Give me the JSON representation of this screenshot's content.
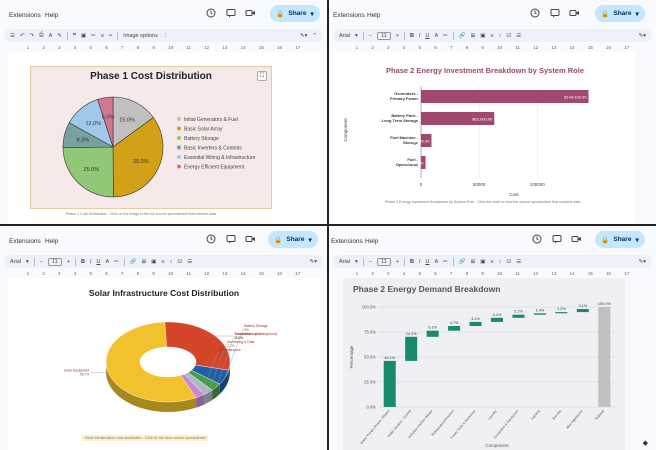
{
  "common": {
    "menu_extensions": "Extensions",
    "menu_help": "Help",
    "share": "Share",
    "font": "Arial",
    "size": "11",
    "ruler": [
      "1",
      "2",
      "3",
      "4",
      "5",
      "6",
      "7",
      "8",
      "9",
      "10",
      "11",
      "12",
      "13",
      "14",
      "15",
      "16",
      "17"
    ]
  },
  "p1": {
    "toolbar_image_options": "Image options",
    "chart_title": "Phase 1 Cost Distribution",
    "caption": "Phase 1 Cost Distribution - Click on the image to the full source spreadsheet that extracts data",
    "chart_data": {
      "type": "pie",
      "title": "Phase 1 Cost Distribution",
      "categories": [
        "Initial Generators & Fuel",
        "Basic Solar Array",
        "Battery Storage",
        "Basic Inverters & Controls",
        "Essential Wiring & Infrastructure",
        "Energy Efficient Equipment"
      ],
      "values": [
        15.0,
        35.0,
        25.0,
        8.3,
        12.0,
        5.0
      ],
      "labels": [
        "15.0%",
        "35.0%",
        "25.0%",
        "8.3%",
        "12.0%",
        "5.0%"
      ],
      "colors": [
        "#c0c0c0",
        "#d4a017",
        "#90c878",
        "#7aa0a0",
        "#9ec8ec",
        "#d07890"
      ]
    }
  },
  "p2": {
    "chart_title": "Phase 2 Energy Investment Breakdown by System Role",
    "caption": "Phase 2 Energy Investment Breakdown by System Role - Click the chart to view the source spreadsheet that contains data",
    "chart_data": {
      "type": "bar",
      "orientation": "horizontal",
      "title": "Phase 2 Energy Investment Breakdown by System Role",
      "xlabel": "Cost",
      "ylabel": "Component",
      "categories": [
        "Generators - Primary Power",
        "Battery Pack - Long Term Storage",
        "Fuel Machine - Storage",
        "Fuel - Operational"
      ],
      "values": [
        144100,
        63000,
        9000,
        3900
      ],
      "value_labels": [
        "$144,100.00",
        "$63,000.00",
        "$9,000.00",
        "$3,900.00"
      ],
      "xticks": [
        "0",
        "50000",
        "100000"
      ],
      "xlim": [
        0,
        160000
      ],
      "color": "#a04870"
    }
  },
  "p3": {
    "chart_title": "Solar Infrastructure Cost Distribution",
    "caption": "Solar Infrastructure cost distribution - Click for the more source spreadsheet",
    "chart_data": {
      "type": "pie",
      "variant": "3d-donut",
      "title": "Solar Infrastructure Cost Distribution",
      "categories": [
        "Solar Equipment",
        "Transmission (Underground)",
        "Battery Storage",
        "Installation Labor",
        "Monitoring & Data",
        "Miscellaneous"
      ],
      "values": [
        56.7,
        29.1,
        6.0,
        3.1,
        2.7,
        2.4
      ],
      "colors": [
        "#f2c12e",
        "#d5452a",
        "#1d5fa8",
        "#4a9a48",
        "#b0b8c8",
        "#c888d0"
      ]
    }
  },
  "p4": {
    "chart_title": "Phase 2 Energy Demand Breakdown",
    "chart_data": {
      "type": "bar",
      "variant": "waterfall",
      "title": "Phase 2 Energy Demand Breakdown",
      "xlabel": "Component",
      "ylabel": "Percentage",
      "categories": [
        "Water Pumps (Power, Winter)",
        "Water Heaters - Overall",
        "Induction Kitchen Range",
        "Refrigerators/Freezers",
        "Power Tools & Workshop",
        "Laundry",
        "Computers & Electronics",
        "Lighting",
        "Security",
        "Misc Appliances",
        "Subtotal"
      ],
      "values": [
        46.1,
        24.1,
        6.1,
        4.7,
        4.1,
        4.1,
        3.1,
        1.4,
        1.2,
        3.1,
        100.0
      ],
      "value_labels": [
        "46.1%",
        "24.1%",
        "6.1%",
        "4.7%",
        "4.1%",
        "4.1%",
        "3.1%",
        "1.4%",
        "1.2%",
        "3.1%",
        "100.0%"
      ],
      "yticks": [
        "0.0%",
        "25.0%",
        "50.0%",
        "75.0%",
        "100.0%"
      ],
      "ylim": [
        0,
        100
      ],
      "colors": {
        "step": "#1a8a6e",
        "total": "#c0c0c0"
      }
    }
  }
}
